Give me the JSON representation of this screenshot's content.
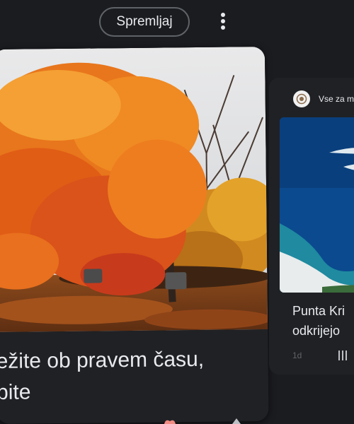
{
  "toolbar": {
    "follow_label": "Spremljaj",
    "more_icon": "more-vert-icon"
  },
  "main_card": {
    "image_subject": "autumn-maple-tree-photo",
    "headline": "ežite ob pravem času,\npite"
  },
  "side_card": {
    "source_name": "Vse za m",
    "image_subject": "coastline-aerial-photo",
    "title": "Punta Kri\nodkrijejo",
    "age": "1d",
    "menu_icon": "bars-icon"
  },
  "colors": {
    "background": "#1b1c20",
    "card": "#202124",
    "text": "#e8eaed",
    "border": "#5f6368"
  }
}
